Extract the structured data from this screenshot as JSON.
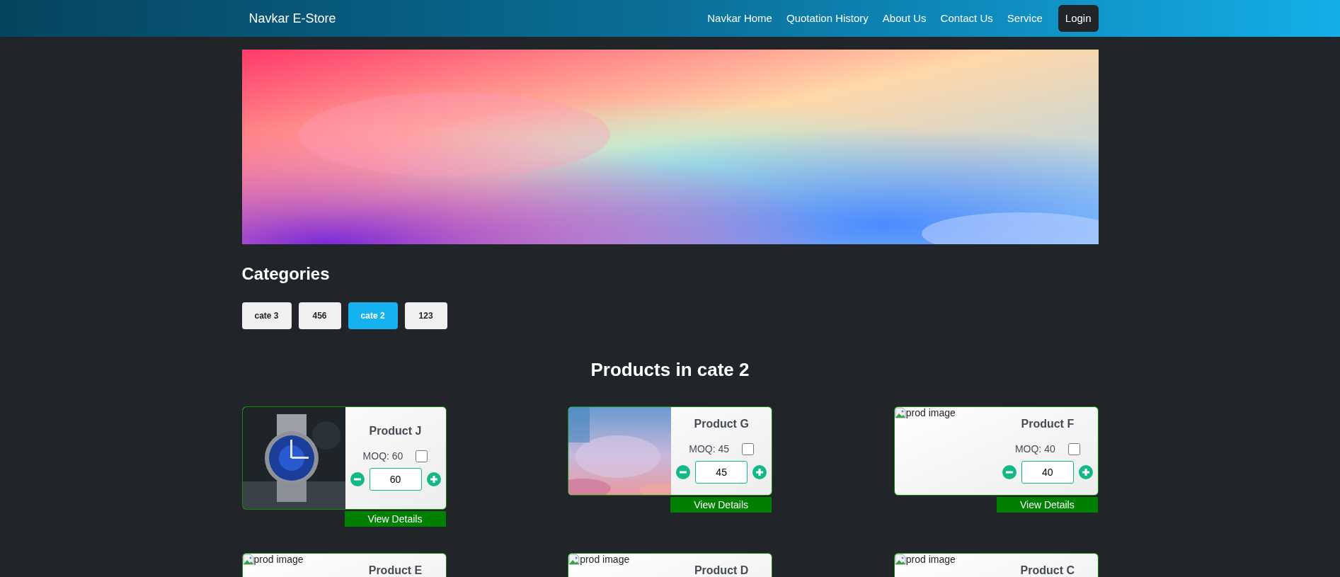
{
  "navbar": {
    "brand": "Navkar E-Store",
    "links": [
      {
        "label": "Navkar Home",
        "kind": "link"
      },
      {
        "label": "Quotation History",
        "kind": "link"
      },
      {
        "label": "About Us",
        "kind": "link"
      },
      {
        "label": "Contact Us",
        "kind": "link"
      },
      {
        "label": "Service",
        "kind": "link"
      },
      {
        "label": "Login",
        "kind": "button"
      }
    ]
  },
  "categories": {
    "title": "Categories",
    "items": [
      {
        "label": "cate 3",
        "selected": false
      },
      {
        "label": "456",
        "selected": false
      },
      {
        "label": "cate 2",
        "selected": true
      },
      {
        "label": "123",
        "selected": false
      }
    ]
  },
  "products": {
    "title": "Products in cate 2",
    "items": [
      {
        "name": "Product J",
        "image": {
          "kind": "watch"
        },
        "moq": "MOQ: 60",
        "checked": false,
        "quantity": "60",
        "button": "View Details"
      },
      {
        "name": "Product G",
        "image": {
          "kind": "gradient"
        },
        "moq": "MOQ: 45",
        "checked": false,
        "quantity": "45",
        "button": "View Details"
      },
      {
        "name": "Product F",
        "image": {
          "kind": "broken",
          "alt": "prod image"
        },
        "moq": "MOQ: 40",
        "checked": false,
        "quantity": "40",
        "button": "View Details"
      },
      {
        "name": "Product E",
        "image": {
          "kind": "broken",
          "alt": "prod image"
        }
      },
      {
        "name": "Product D",
        "image": {
          "kind": "broken",
          "alt": "prod image"
        }
      },
      {
        "name": "Product C",
        "image": {
          "kind": "broken",
          "alt": "prod image"
        }
      }
    ]
  }
}
